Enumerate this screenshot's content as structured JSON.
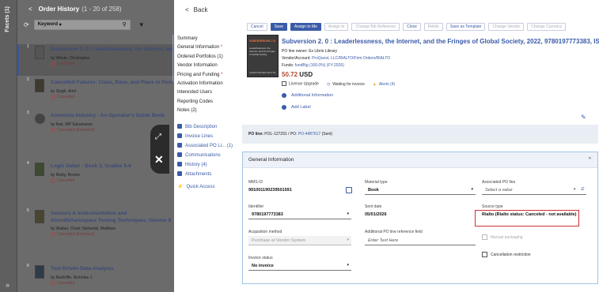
{
  "left": {
    "facets_label": "Facets (1)",
    "collapse_label": "»",
    "header_back": "<",
    "header_title": "Order History",
    "header_count": "(1 - 20 of 258)",
    "keyword_label": "Keyword",
    "items": [
      {
        "num": "1",
        "title": "Subversion 2. 0 : Leaderlessness, the Internet, and the Fringes of Global Society",
        "by": "by Whyte, Christopher",
        "status": "Cancelled"
      },
      {
        "num": "2",
        "title": "Cancelled Futures: Class, Race, and Place in Post-Industrial America",
        "by": "by Singh, Amit",
        "status": "Cancelled"
      },
      {
        "num": "3",
        "title": "Ammonia Industry : An Operator's Guide Book",
        "by": "by Nair, MP Sukumaran",
        "status": "Cancelled (Activated)"
      },
      {
        "num": "4",
        "title": "Logic Safari : Book 3, Grades 5-6",
        "by": "by Risby, Bonnie",
        "status": "Cancelled"
      },
      {
        "num": "5",
        "title": "Sensors & Instrumentation and Aircraft/Aerospace Testing Techniques, Volume 8 : Proceedings of the 36th IMAC, A Conference and Exp",
        "by": "by Walber, Chad; Stefanski, Matthew",
        "status": "Cancelled (Activated)"
      },
      {
        "num": "6",
        "title": "Test-Driven Data Analysis",
        "by": "by Radcliffe, Nicholas J.",
        "status": "Cancelled"
      }
    ]
  },
  "main": {
    "back_label": "Back",
    "nav": [
      {
        "label": "Summary",
        "req": false
      },
      {
        "label": "General Information",
        "req": true
      },
      {
        "label": "Ordered Portfolios (1)",
        "req": false
      },
      {
        "label": "Vendor Information",
        "req": false
      },
      {
        "label": "Pricing and Funding",
        "req": true
      },
      {
        "label": "Activation Information",
        "req": false
      },
      {
        "label": "Interested Users",
        "req": false
      },
      {
        "label": "Reporting Codes",
        "req": false
      },
      {
        "label": "Notes (2)",
        "req": false
      }
    ],
    "nav_links": [
      "Bib Description",
      "Invoice Lines",
      "Associated PO Li... (1)",
      "Communications",
      "History (4)",
      "Attachments"
    ],
    "quick_access": "Quick Access",
    "buttons": {
      "cancel": "Cancel",
      "save": "Save",
      "assign_me": "Assign to Me",
      "assign_to": "Assign to",
      "change_bib": "Change Bib Reference",
      "close": "Close",
      "relink": "Relink",
      "save_template": "Save as Template",
      "change_vendor": "Change Vendor",
      "change_currency": "Change Currency"
    },
    "cover": {
      "t1": "SUBVERSION 2.0",
      "t2": "Leaderlessness, the Internet, and the Fringes of Global Society",
      "t3": "CHRISTOPHER WHYTE"
    },
    "title": "Subversion 2. 0 : Leaderlessness, the Internet, and the Fringes of Global Society, 2022, 9780197773383, ISBN",
    "owner_label": "PO line owner:",
    "owner_value": "Ex Libris Library",
    "vendor_label": "Vendor/Account:",
    "vendor_value": "ProQuest, LLC/RIALTO/Firm Orders/RIALTO",
    "funds_label": "Funds:",
    "funds_value": "fundBig (100.0%) (FY-2026)",
    "price_value": "50.72",
    "price_currency": "USD",
    "license": "License Upgrade",
    "waiting": "Waiting for invoice",
    "alerts": "Alerts (4)",
    "additional_info": "Additional Information",
    "add_label": "Add Label",
    "po_line_label": "PO line:",
    "po_line_value": "POL-127291",
    "po_label": "/ PO:",
    "po_value": "PO-4487617",
    "po_status": "(Sent)",
    "gi_title": "General Information",
    "fields": {
      "mms_label": "MMS ID",
      "mms_value": "991001190239501591",
      "material_label": "Material type",
      "material_value": "Book",
      "assoc_label": "Associated PO line",
      "assoc_placeholder": "Select a value",
      "ident_label": "Identifier",
      "ident_value": "9780197773383",
      "sent_label": "Sent date",
      "sent_value": "05/01/2026",
      "source_label": "Source type",
      "source_value": "Rialto (Rialto status: Canceled - not available)",
      "acq_label": "Acquisition method",
      "acq_value": "Purchase at Vendor System",
      "addpo_label": "Additional PO line reference field",
      "addpo_placeholder": "Enter Text Here",
      "manual_label": "Manual packaging",
      "invoice_label": "Invoice status",
      "invoice_value": "No invoice",
      "cancel_restr_label": "Cancellation restriction"
    }
  }
}
